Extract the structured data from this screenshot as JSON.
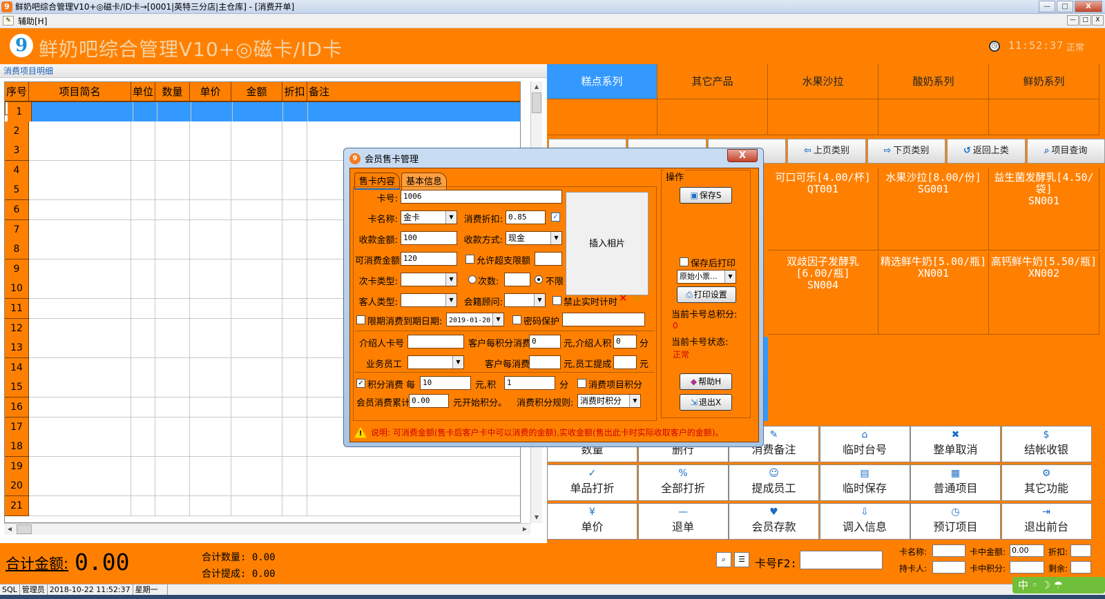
{
  "window": {
    "title": "鲜奶吧综合管理V10+◎磁卡/ID卡→[0001|英特三分店|主仓库] - [消费开单]",
    "min": "—",
    "max": "□",
    "close": "X"
  },
  "menu": {
    "assist": "辅助[H]"
  },
  "header": {
    "app_title": "鲜奶吧综合管理V10+◎磁卡/ID卡",
    "time": "11:52:37",
    "status": "正常"
  },
  "left": {
    "section_label": "消费项目明细",
    "columns": [
      "序号",
      "项目简名",
      "单位",
      "数量",
      "单价",
      "金额",
      "折扣",
      "备注"
    ],
    "rows": [
      "1",
      "2",
      "3",
      "4",
      "5",
      "6",
      "7",
      "8",
      "9",
      "10",
      "11",
      "12",
      "13",
      "14",
      "15",
      "16",
      "17",
      "18",
      "19",
      "20",
      "21"
    ]
  },
  "right": {
    "categories": [
      "糕点系列",
      "其它产品",
      "水果沙拉",
      "酸奶系列",
      "鲜奶系列"
    ],
    "nav_buttons": [
      "上页类别",
      "下页类别",
      "返回上类",
      "项目查询"
    ],
    "products": [
      {
        "name": "可口可乐[4.00/杯]",
        "code": "QT001"
      },
      {
        "name": "水果沙拉[8.00/份]",
        "code": "SG001"
      },
      {
        "name": "益生菌发酵乳[4.50/袋]",
        "code": "SN001"
      },
      {
        "name": "双歧因子发酵乳[6.00/瓶]",
        "code": "SN004"
      },
      {
        "name": "精选鲜牛奶[5.00/瓶]",
        "code": "XN001"
      },
      {
        "name": "高钙鲜牛奶[5.50/瓶]",
        "code": "XN002"
      }
    ],
    "func_buttons": [
      [
        "数量",
        "删行",
        "消费备注",
        "临时台号",
        "整单取消",
        "结帐收银"
      ],
      [
        "单品打折",
        "全部打折",
        "提成员工",
        "临时保存",
        "普通项目",
        "其它功能"
      ],
      [
        "单价",
        "退单",
        "会员存款",
        "调入信息",
        "预订项目",
        "退出前台"
      ]
    ]
  },
  "bottom": {
    "total_label": "合计金额:",
    "total_value": "0.00",
    "sum_qty": "合计数量: 0.00",
    "sum_commission": "合计提成: 0.00",
    "card_label": "卡号F2:",
    "card_name_label": "卡名称:",
    "card_amount_label": "卡中金额:",
    "card_amount_value": "0.00",
    "discount_label": "折扣:",
    "holder_label": "持卡人:",
    "card_points_label": "卡中积分:",
    "surplus_label": "剩余:"
  },
  "statusbar": {
    "db": "SQL",
    "user": "管理员",
    "datetime": "2018-10-22 11:52:37",
    "weekday": "星期一",
    "ime": "中 ◦ ☽ ☂"
  },
  "dialog": {
    "title": "会员售卡管理",
    "close": "X",
    "tabs": [
      "售卡内容",
      "基本信息"
    ],
    "card_no_label": "卡号:",
    "card_no": "1006",
    "card_name_label": "卡名称:",
    "card_name": "金卡",
    "discount_label": "消费折扣:",
    "discount": "0.85",
    "collect_label": "收款金额:",
    "collect": "100",
    "paymethod_label": "收款方式:",
    "paymethod": "现金",
    "spendable_label": "可消费金额:",
    "spendable": "120",
    "overdraft_label": "允许超支",
    "limit_label": "限额",
    "subcard_label": "次卡类型:",
    "times_label": "次数:",
    "unlimited_label": "不限",
    "guest_type_label": "客人类型:",
    "advisor_label": "会籍顾问:",
    "no_realtime_label": "禁止实时计时",
    "limit_period_label": "限期消费",
    "expire_label": "到期日期:",
    "expire": "2019-01-20",
    "password_label": "密码保护",
    "photo_label": "插入相片",
    "referrer_label": "介绍人卡号",
    "points_per_label": "客户每积分消费",
    "points_per": "0",
    "yuan_referrer_label": "元,介绍人积",
    "referrer_points": "0",
    "fen": "分",
    "staff_label": "业务员工",
    "per_spend_label": "客户每消费",
    "yuan_staff_label": "元,员工提成",
    "yuan": "元",
    "points_consume_label": "积分消费",
    "each_label": "每",
    "each_value": "10",
    "yuan_points_label": "元,积",
    "points_value": "1",
    "item_points_label": "消费项目积分",
    "accum_label": "会员消费累计",
    "accum": "0.00",
    "start_points_label": "元开始积分。",
    "rule_label": "消费积分规则:",
    "rule": "消费时积分",
    "ops_title": "操作",
    "save_btn": "保存S",
    "print_after_save": "保存后打印",
    "receipt_select": "原始小票...",
    "print_settings": "打印设置",
    "total_points_label": "当前卡号总积分:",
    "total_points": "0",
    "status_label": "当前卡号状态:",
    "status": "正常",
    "help_btn": "帮助H",
    "exit_btn": "退出X",
    "note": "说明: 可消费金额(售卡后客户卡中可以消费的金额),实收金额(售出此卡时实际收取客户的金额)。"
  }
}
